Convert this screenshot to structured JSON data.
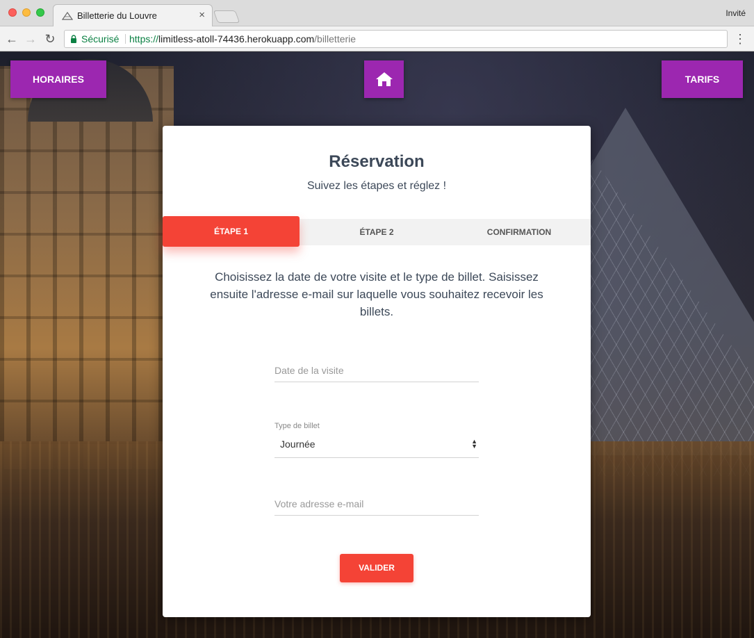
{
  "browser": {
    "tab_title": "Billetterie du Louvre",
    "tab_close": "×",
    "profile": "Invité",
    "secure_label": "Sécurisé",
    "url_scheme": "https://",
    "url_host": "limitless-atoll-74436.herokuapp.com",
    "url_path": "/billetterie",
    "back_icon": "←",
    "forward_icon": "→",
    "reload_icon": "↻",
    "menu_icon": "⋮"
  },
  "topnav": {
    "horaires_label": "HORAIRES",
    "home_icon": "home-icon",
    "tarifs_label": "TARIFS",
    "accent_color": "#9c27b0"
  },
  "card": {
    "title": "Réservation",
    "subtitle": "Suivez les étapes et réglez !",
    "steps": [
      {
        "label": "ÉTAPE 1",
        "active": true
      },
      {
        "label": "ÉTAPE 2",
        "active": false
      },
      {
        "label": "CONFIRMATION",
        "active": false
      }
    ],
    "intro": "Choisissez la date de votre visite et le type de billet. Saisissez ensuite l'adresse e-mail sur laquelle vous souhaitez recevoir les billets.",
    "form": {
      "date_placeholder": "Date de la visite",
      "date_value": "",
      "type_label": "Type de billet",
      "type_value": "Journée",
      "email_placeholder": "Votre adresse e-mail",
      "email_value": "",
      "submit_label": "VALIDER"
    },
    "accent_color": "#f44336"
  }
}
